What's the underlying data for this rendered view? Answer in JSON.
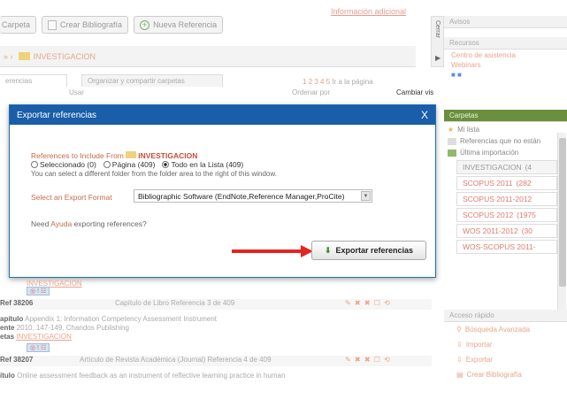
{
  "toolbar": {
    "carpeta_label": "Carpeta",
    "crear_bib_label": "Crear Bibliografía",
    "nueva_ref_label": "Nueva Referencia",
    "info_link": "Información adicional"
  },
  "folderbar": {
    "path": "INVESTIGACION"
  },
  "tabs": {
    "tab1": "erencias",
    "tab2": "Organizar y compartir carpetas"
  },
  "pager": {
    "pages": "1 2 3 4 5",
    "suffix": "Ir a la página"
  },
  "columns": {
    "c1": "Usar",
    "c2": "Ordenar por",
    "c3": "Cambiar vis"
  },
  "modal": {
    "title": "Exportar referencias",
    "close": "X",
    "include_prefix": "References to Include From",
    "folder_name": "INVESTIGACION",
    "radio1": "Seleccionado (0)",
    "radio2": "Página (409)",
    "radio3": "Todo en la Lista (409)",
    "hint": "You can select a different folder from the folder area to the right of this window.",
    "format_label": "Select an Export Format",
    "format_value": "Bibliographic Software (EndNote,Reference Manager,ProCite)",
    "need_prefix": "Need",
    "need_link": "Ayuda",
    "need_suffix": "exporting references?",
    "export_button": "Exportar referencias"
  },
  "rows": {
    "r1_folder": "INVESTIGACION",
    "r2_id": "Ref  38206",
    "r2_type": "Capítulo de Libro Referencia 3 de 409",
    "r2_k1": "apítulo",
    "r2_v1": "Appendix 1: Information Competency Assessment Instrument",
    "r2_k2": "ente",
    "r2_v2": "2010, 147-149, Chandos Publishing",
    "r2_k3": "etas",
    "r2_v3": "INVESTIGACION",
    "r3_id": "Ref  38207",
    "r3_type": "Artículo de Revista Académica (Journal) Referencia 4 de 409",
    "r3_k1": "ítulo",
    "r3_v1": "Online assessment feedback as an instrument of reflective learning practice in human"
  },
  "sidebar": {
    "avisos": "Avisos",
    "recursos": "Recursos",
    "centro": "Centro de asistencia",
    "webinars": "Webinars",
    "carpetas": "Carpetas",
    "minivela": "Mi lista",
    "refs_no": "Referencias que no están",
    "ultima": "Última importación",
    "folders": [
      "INVESTIGACION",
      "SCOPUS 2011",
      "SCOPUS 2011-2012",
      "SCOPUS 2012",
      "WOS 2011-2012",
      "WOS-SCOPUS 2011-"
    ],
    "folder_counts": [
      "(4",
      "(282",
      "",
      "(1975",
      "(30",
      ""
    ],
    "acceso": "Acceso rápido",
    "quick": [
      "Búsqueda Avanzada",
      "Importar",
      "Exportar",
      "Crear Bibliografía"
    ],
    "cerrar": "Cerrar"
  }
}
